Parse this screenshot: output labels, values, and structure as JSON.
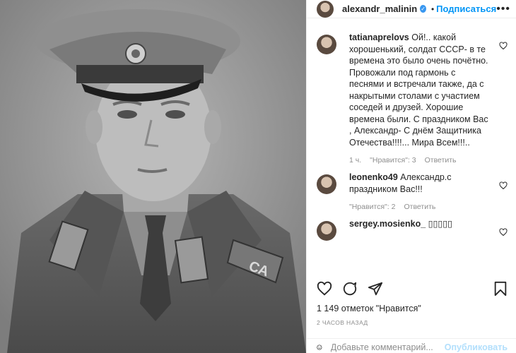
{
  "post": {
    "author": "alexandr_malinin",
    "follow_label": "Подписаться",
    "separator": "•",
    "more_icon": "ellipsis-icon",
    "photo_badge_text": "СА"
  },
  "comments": [
    {
      "user": "tatianaprelovs",
      "text": "Ой!.. какой хорошенький, солдат СССР- в те времена это было очень почётно. Провожали под гармонь с песнями и встречали также, да с накрытыми столами с участием соседей и друзей. Хорошие времена были. С праздником Вас , Александр- С днём Защитника Отечества!!!!... Мира Всем!!!..",
      "age": "1 ч.",
      "likes": "\"Нравится\": 3",
      "reply": "Ответить"
    },
    {
      "user": "leonenko49",
      "text": "Александр.с праздником Вас!!!",
      "age": "",
      "likes": "\"Нравится\": 2",
      "reply": "Ответить"
    },
    {
      "user": "sergey.mosienko_",
      "text": "▯▯▯▯▯"
    }
  ],
  "likes_text": "1 149 отметок \"Нравится\"",
  "time_text": "2 ЧАСОВ НАЗАД",
  "add_comment": {
    "placeholder": "Добавьте комментарий...",
    "publish_label": "Опубликовать"
  },
  "colors": {
    "accent": "#0095f6",
    "publish_disabled": "#b2dffc",
    "meta": "#8e8e8e",
    "text": "#262626"
  }
}
